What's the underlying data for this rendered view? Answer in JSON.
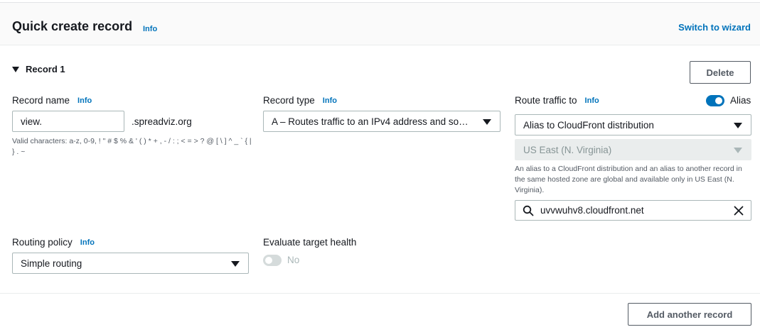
{
  "header": {
    "title": "Quick create record",
    "info": "Info",
    "switch_wizard": "Switch to wizard"
  },
  "record": {
    "title": "Record 1",
    "delete_label": "Delete"
  },
  "record_name": {
    "label": "Record name",
    "info": "Info",
    "value": "view.",
    "suffix": ".spreadviz.org",
    "hint": "Valid characters: a-z, 0-9, ! \" # $ % & ' ( ) * + , - / : ; < = > ? @ [ \\ ] ^ _ ` { | } . ~"
  },
  "record_type": {
    "label": "Record type",
    "info": "Info",
    "value": "A – Routes traffic to an IPv4 address and so…"
  },
  "route_traffic": {
    "label": "Route traffic to",
    "info": "Info",
    "alias_label": "Alias",
    "alias_on": true,
    "target_value": "Alias to CloudFront distribution",
    "region_value": "US East (N. Virginia)",
    "hint": "An alias to a CloudFront distribution and an alias to another record in the same hosted zone are global and available only in US East (N. Virginia).",
    "search_value": "uvvwuhv8.cloudfront.net"
  },
  "routing_policy": {
    "label": "Routing policy",
    "info": "Info",
    "value": "Simple routing"
  },
  "evaluate_health": {
    "label": "Evaluate target health",
    "toggle_label": "No",
    "enabled": false
  },
  "footer": {
    "add_label": "Add another record"
  },
  "icons": {
    "search": "search-icon",
    "clear": "close-icon",
    "caret": "caret-down-icon"
  },
  "colors": {
    "link": "#0073bb",
    "toggle_on": "#0073bb",
    "disabled_bg": "#eaeded"
  }
}
